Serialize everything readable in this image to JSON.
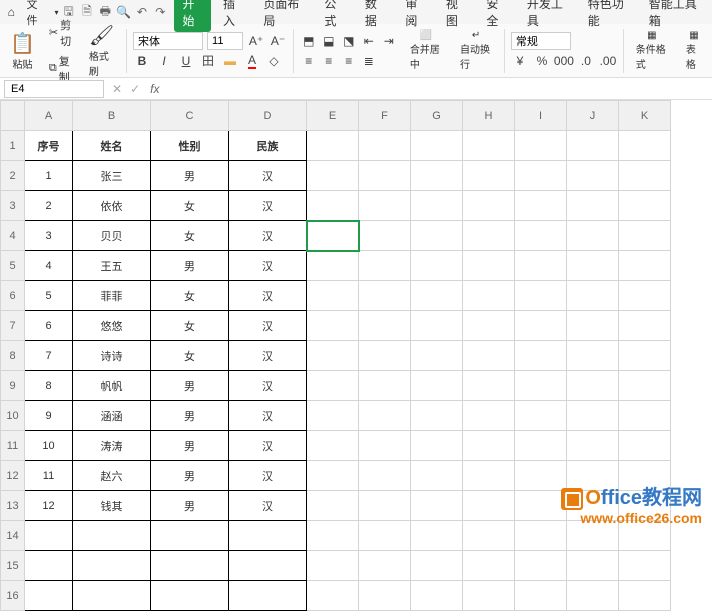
{
  "menubar": {
    "file_label": "文件",
    "tabs": [
      "开始",
      "插入",
      "页面布局",
      "公式",
      "数据",
      "审阅",
      "视图",
      "安全",
      "开发工具",
      "特色功能",
      "智能工具箱"
    ],
    "active_tab": 0
  },
  "ribbon": {
    "paste_label": "粘贴",
    "cut_label": "剪切",
    "copy_label": "复制",
    "format_painter": "格式刷",
    "font_name": "宋体",
    "font_size": "11",
    "merge_label": "合并居中",
    "wrap_label": "自动换行",
    "number_format": "常规",
    "cond_format": "条件格式",
    "table_style": "表格"
  },
  "name_box": "E4",
  "grid": {
    "columns": [
      "A",
      "B",
      "C",
      "D",
      "E",
      "F",
      "G",
      "H",
      "I",
      "J",
      "K"
    ],
    "headers": [
      "序号",
      "姓名",
      "性别",
      "民族"
    ],
    "rows": [
      {
        "n": "1",
        "name": "张三",
        "sex": "男",
        "eth": "汉"
      },
      {
        "n": "2",
        "name": "依依",
        "sex": "女",
        "eth": "汉"
      },
      {
        "n": "3",
        "name": "贝贝",
        "sex": "女",
        "eth": "汉"
      },
      {
        "n": "4",
        "name": "王五",
        "sex": "男",
        "eth": "汉"
      },
      {
        "n": "5",
        "name": "菲菲",
        "sex": "女",
        "eth": "汉"
      },
      {
        "n": "6",
        "name": "悠悠",
        "sex": "女",
        "eth": "汉"
      },
      {
        "n": "7",
        "name": "诗诗",
        "sex": "女",
        "eth": "汉"
      },
      {
        "n": "8",
        "name": "帆帆",
        "sex": "男",
        "eth": "汉"
      },
      {
        "n": "9",
        "name": "涵涵",
        "sex": "男",
        "eth": "汉"
      },
      {
        "n": "10",
        "name": "涛涛",
        "sex": "男",
        "eth": "汉"
      },
      {
        "n": "11",
        "name": "赵六",
        "sex": "男",
        "eth": "汉"
      },
      {
        "n": "12",
        "name": "钱其",
        "sex": "男",
        "eth": "汉"
      }
    ],
    "extra_rows": 3,
    "active_cell": "E4"
  },
  "watermark": {
    "brand_o": "O",
    "brand_rest": "ffice教程网",
    "url": "www.office26.com"
  }
}
